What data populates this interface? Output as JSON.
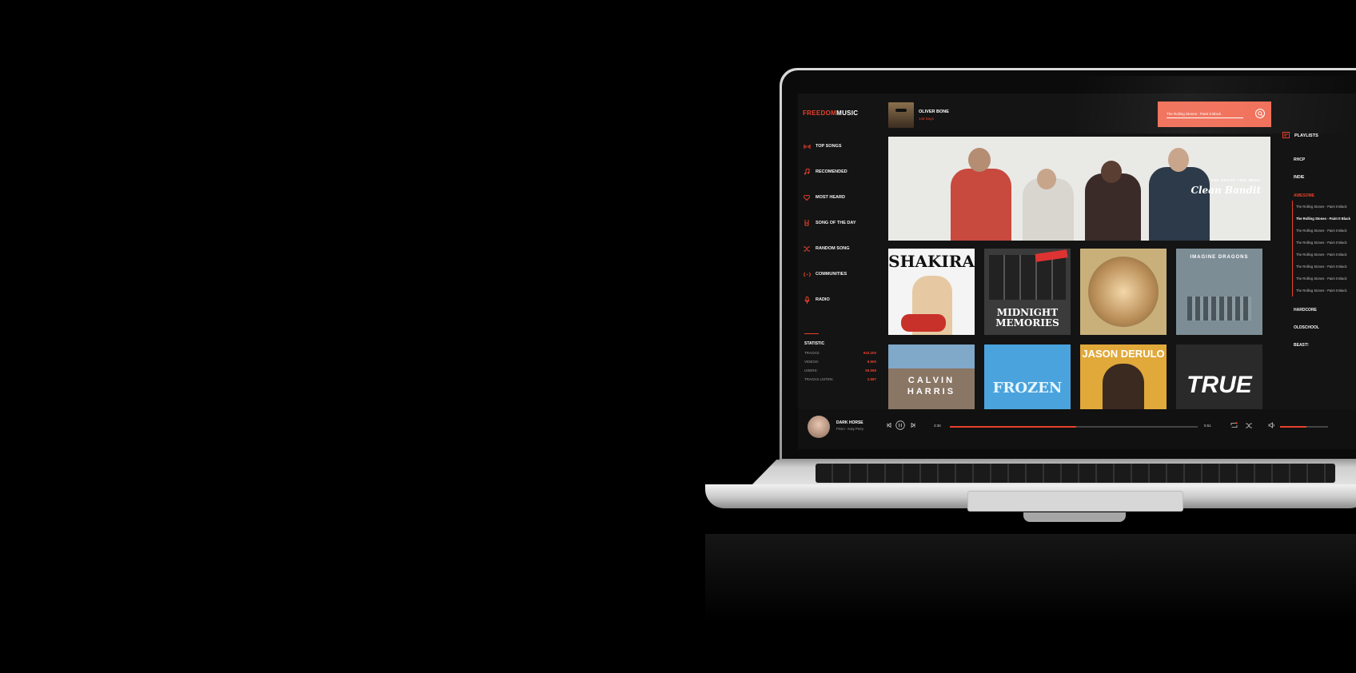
{
  "colors": {
    "accent": "#e8412c",
    "search_bg": "#f06e57",
    "screen_bg": "#141414"
  },
  "brand": {
    "part1": "FREEDOM",
    "part2": "MUSIC"
  },
  "user": {
    "name": "OLIVER BONE",
    "subtitle": "149 Days"
  },
  "search": {
    "value": "The Rolling Stones - Paint It Black",
    "icon": "search-icon"
  },
  "nav": [
    {
      "label": "TOP SONGS",
      "icon": "equalizer-icon"
    },
    {
      "label": "RECOMENDED",
      "icon": "music-note-icon"
    },
    {
      "label": "MOST HEARD",
      "icon": "heart-icon"
    },
    {
      "label": "SONG OF THE DAY",
      "icon": "rock-hand-icon"
    },
    {
      "label": "RANDOM SONG",
      "icon": "shuffle-icon"
    },
    {
      "label": "COMMUNITIES",
      "icon": "broadcast-icon"
    },
    {
      "label": "RADIO",
      "icon": "microphone-icon"
    }
  ],
  "stats": {
    "title": "STATISTIC",
    "rows": [
      {
        "label": "TRACKS:",
        "value": "932.200"
      },
      {
        "label": "VIDEOS:",
        "value": "8.900"
      },
      {
        "label": "USERS:",
        "value": "56.568"
      },
      {
        "label": "TRACKS LISTEN:",
        "value": "2.887"
      }
    ]
  },
  "hero": {
    "kicker": "TOP ARTIST THIS WEEK",
    "artist": "Clean Bandit"
  },
  "albums": [
    {
      "label": "SHAKIRA",
      "bg": "#f4f4f4",
      "fg": "#111"
    },
    {
      "label": "MIDNIGHT MEMORIES",
      "bg": "#3b3b3b",
      "fg": "#fff"
    },
    {
      "label": "",
      "bg": "#c9b07a",
      "fg": "#fff"
    },
    {
      "label": "IMAGINE DRAGONS",
      "bg": "#7d8d96",
      "fg": "#fff"
    },
    {
      "label": "CALVIN HARRIS",
      "bg": "#8a7665",
      "fg": "#fff"
    },
    {
      "label": "FROZEN",
      "bg": "#4aa3dc",
      "fg": "#e7f6ff"
    },
    {
      "label": "JASON DERULO",
      "bg": "#e0a93a",
      "fg": "#fff"
    },
    {
      "label": "TRUE",
      "bg": "#2a2a2a",
      "fg": "#fff"
    }
  ],
  "playlists": {
    "title": "PLAYLISTS",
    "items_top": [
      "RHCP",
      "INDIE"
    ],
    "active": "AWESOME",
    "tracks": [
      "The Rolling Stones - Paint It Black",
      "The Rolling Stones - Paint It Black",
      "The Rolling Stones - Paint It Black",
      "The Rolling Stones - Paint It Black",
      "The Rolling Stones - Paint It Black",
      "The Rolling Stones - Paint It Black",
      "The Rolling Stones - Paint It Black",
      "The Rolling Stones - Paint It Black"
    ],
    "current_track_index": 1,
    "items_bottom": [
      "HARDCORE",
      "OLDSCHOOL",
      "BEAST!"
    ]
  },
  "player": {
    "title": "DARK HORSE",
    "subtitle": "Prism - Katy Perry",
    "elapsed": "3:36",
    "total": "5:51",
    "progress": 0.51,
    "volume": 0.55
  }
}
